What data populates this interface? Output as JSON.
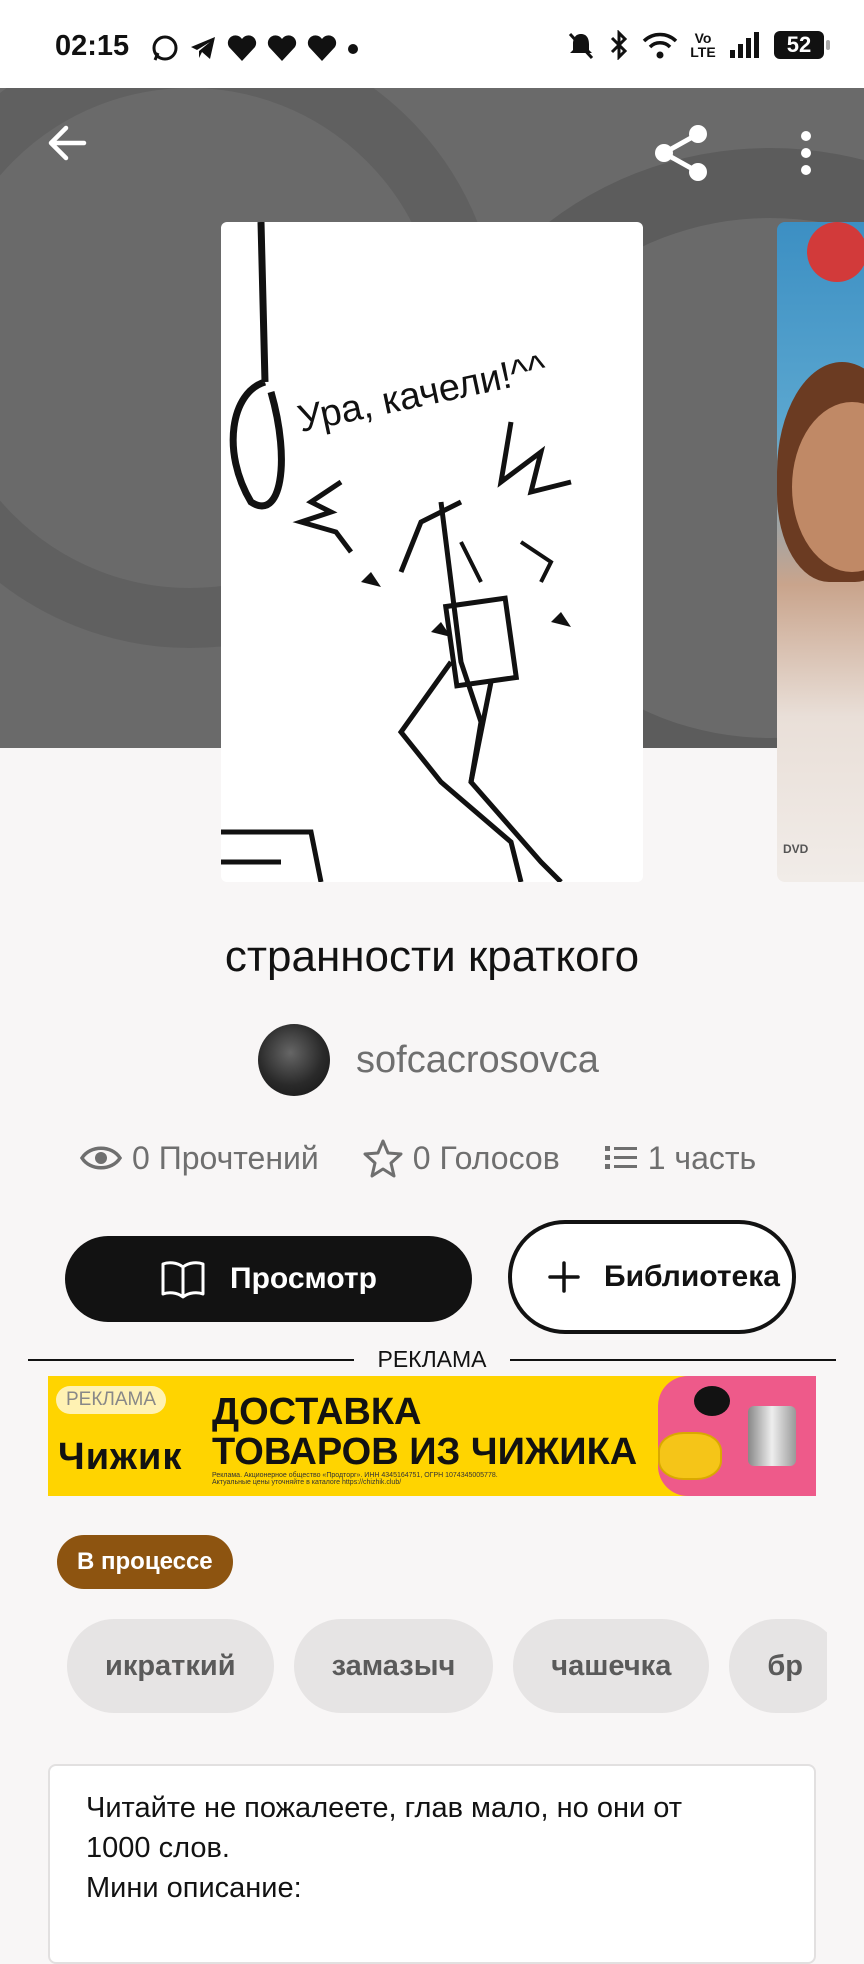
{
  "status_bar": {
    "time": "02:15",
    "battery": "52",
    "network_label": "Vo LTE"
  },
  "colors": {
    "accent_status": "#8d5410",
    "primary_button": "#121212",
    "ad_background": "#ffd400"
  },
  "header": {
    "back_icon": "arrow-left-icon",
    "share_icon": "share-icon",
    "menu_icon": "more-vertical-icon"
  },
  "story": {
    "title": "странности краткого",
    "author": "sofcacrosovca",
    "cover_caption": "Ура, качели!^^",
    "stats": {
      "reads": "0 Прочтений",
      "votes": "0 Голосов",
      "parts": "1 часть"
    },
    "status": "В процессе",
    "tags": [
      "икраткий",
      "замазыч",
      "чашечка",
      "бр"
    ],
    "description": [
      "Читайте не пожалеете, глав мало, но они от",
      "1000 слов.",
      "Мини описание:"
    ]
  },
  "actions": {
    "read_label": "Просмотр",
    "library_label": "Библиотека"
  },
  "ad": {
    "divider_label": "РЕКЛАМА",
    "badge": "РЕКЛАМА",
    "brand": "Чижик",
    "headline_line1": "ДОСТАВКА",
    "headline_line2": "ТОВАРОВ ИЗ ЧИЖИКА",
    "small_print": "Реклама. Акционерное общество «Продторг». ИНН 4345164751, ОГРН 1074345005778. Актуальные цены уточняйте в каталоге https://chizhik.club/"
  }
}
